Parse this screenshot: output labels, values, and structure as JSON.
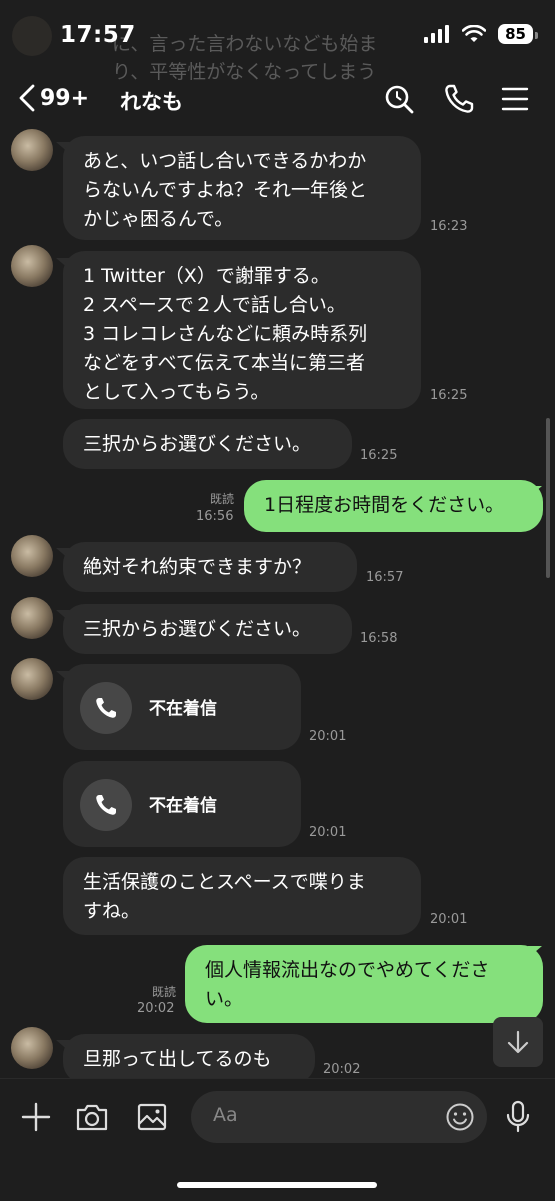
{
  "status": {
    "time": "17:57",
    "battery": "85"
  },
  "ghost": {
    "text": "に、言った言わないなども始まり、平等性がなくなってしまう"
  },
  "header": {
    "back_count": "99+",
    "chat_name": "れなも"
  },
  "messages": [
    {
      "id": "m1",
      "text": "あと、いつ話し合いできるかわか\nらないんですよね？それ一年後と\nかじゃ困るんで。",
      "time": "16:23"
    },
    {
      "id": "m2",
      "text": "1 Twitter（X）で謝罪する。\n2 スペースで２人で話し合い。\n3 コレコレさんなどに頼み時系列\nなどをすべて伝えて本当に第三者\nとして入ってもらう。",
      "time": "16:25"
    },
    {
      "id": "m3",
      "text": "三択からお選びください。",
      "time": "16:25"
    },
    {
      "id": "m4",
      "text": "1日程度お時間をください。",
      "read": "既読",
      "time": "16:56"
    },
    {
      "id": "m5",
      "text": "絶対それ約束できますか？",
      "time": "16:57"
    },
    {
      "id": "m6",
      "text": "三択からお選びください。",
      "time": "16:58"
    },
    {
      "id": "m7",
      "call_label": "不在着信",
      "time": "20:01"
    },
    {
      "id": "m8",
      "call_label": "不在着信",
      "time": "20:01"
    },
    {
      "id": "m9",
      "text": "生活保護のことスペースで喋りま\nすね。",
      "time": "20:01"
    },
    {
      "id": "m10",
      "text": "個人情報流出なのでやめてくださ\nい。",
      "read": "既読",
      "time": "20:02"
    },
    {
      "id": "m11",
      "text": "旦那って出してるのも",
      "time": "20:02"
    }
  ],
  "input": {
    "placeholder": "Aa"
  },
  "colors": {
    "background": "#1e1e1e",
    "bubble_incoming": "#2c2c2c",
    "bubble_outgoing": "#85e07c"
  }
}
